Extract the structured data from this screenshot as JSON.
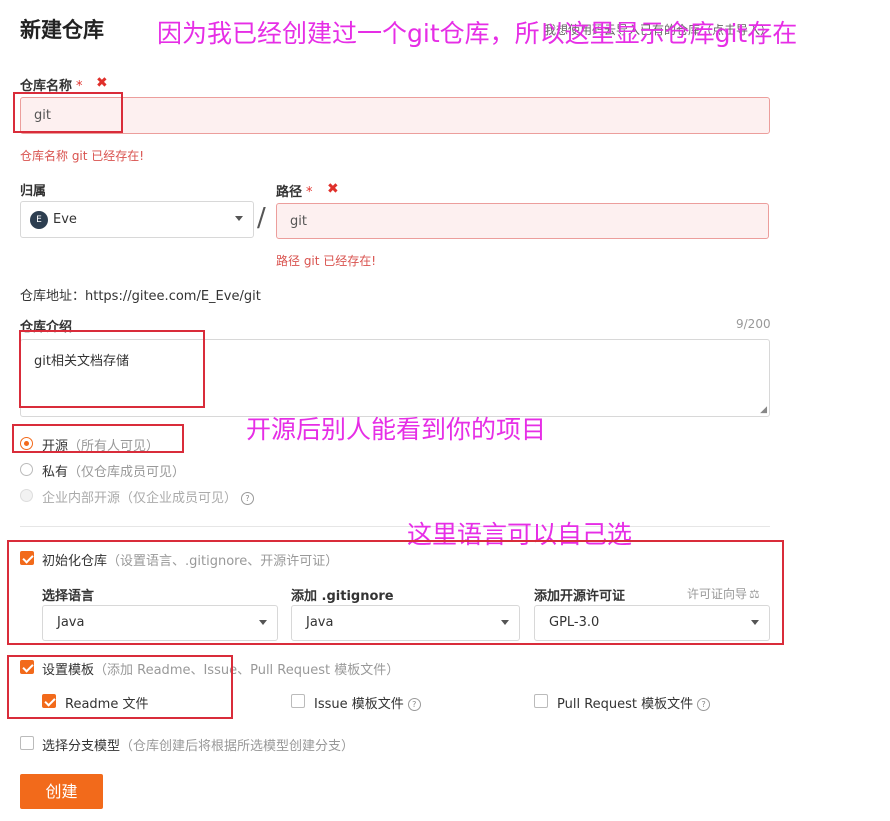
{
  "page": {
    "title": "新建仓库",
    "faint_link": "我想使用码云导入已有的仓库（点击导入）"
  },
  "annotations": {
    "top": "因为我已经创建过一个git仓库，所以这里显示仓库git存在",
    "open_source": "开源后别人能看到你的项目",
    "language": "这里语言可以自己选"
  },
  "repo_name": {
    "label": "仓库名称",
    "required_mark": "*",
    "error_icon": "✖",
    "value": "git",
    "error": "仓库名称 git 已经存在!"
  },
  "owner": {
    "label": "归属",
    "avatar_letter": "E",
    "value": "Eve",
    "separator": "/"
  },
  "path": {
    "label": "路径",
    "required_mark": "*",
    "error_icon": "✖",
    "value": "git",
    "error": "路径 git 已经存在!"
  },
  "repo_url": {
    "text": "仓库地址：https://gitee.com/E_Eve/git"
  },
  "description": {
    "label": "仓库介绍",
    "counter": "9/200",
    "value": "git相关文档存储"
  },
  "visibility": {
    "options": [
      {
        "label": "开源",
        "hint": "（所有人可见）"
      },
      {
        "label": "私有",
        "hint": "（仅仓库成员可见）"
      },
      {
        "label": "企业内部开源",
        "hint": "（仅企业成员可见）"
      }
    ],
    "selected": "开源"
  },
  "init_repo": {
    "label": "初始化仓库",
    "hint": "（设置语言、.gitignore、开源许可证）",
    "checked": true,
    "language": {
      "label": "选择语言",
      "value": "Java"
    },
    "gitignore": {
      "label": "添加 .gitignore",
      "value": "Java"
    },
    "license": {
      "label": "添加开源许可证",
      "value": "GPL-3.0",
      "guide": "许可证向导"
    }
  },
  "template": {
    "label": "设置模板",
    "hint": "（添加 Readme、Issue、Pull Request 模板文件）",
    "checked": true,
    "readme": {
      "label": "Readme 文件",
      "checked": true
    },
    "issue": {
      "label": "Issue 模板文件",
      "checked": false
    },
    "pull_request": {
      "label": "Pull Request 模板文件",
      "checked": false
    }
  },
  "branch_model": {
    "label": "选择分支模型",
    "hint": "（仓库创建后将根据所选模型创建分支）",
    "checked": false
  },
  "submit": {
    "label": "创建"
  },
  "colors": {
    "accent": "#f26a1b",
    "annotation": "#e62ee6",
    "error": "#d9534f",
    "highlight_box": "#d92c3a"
  }
}
